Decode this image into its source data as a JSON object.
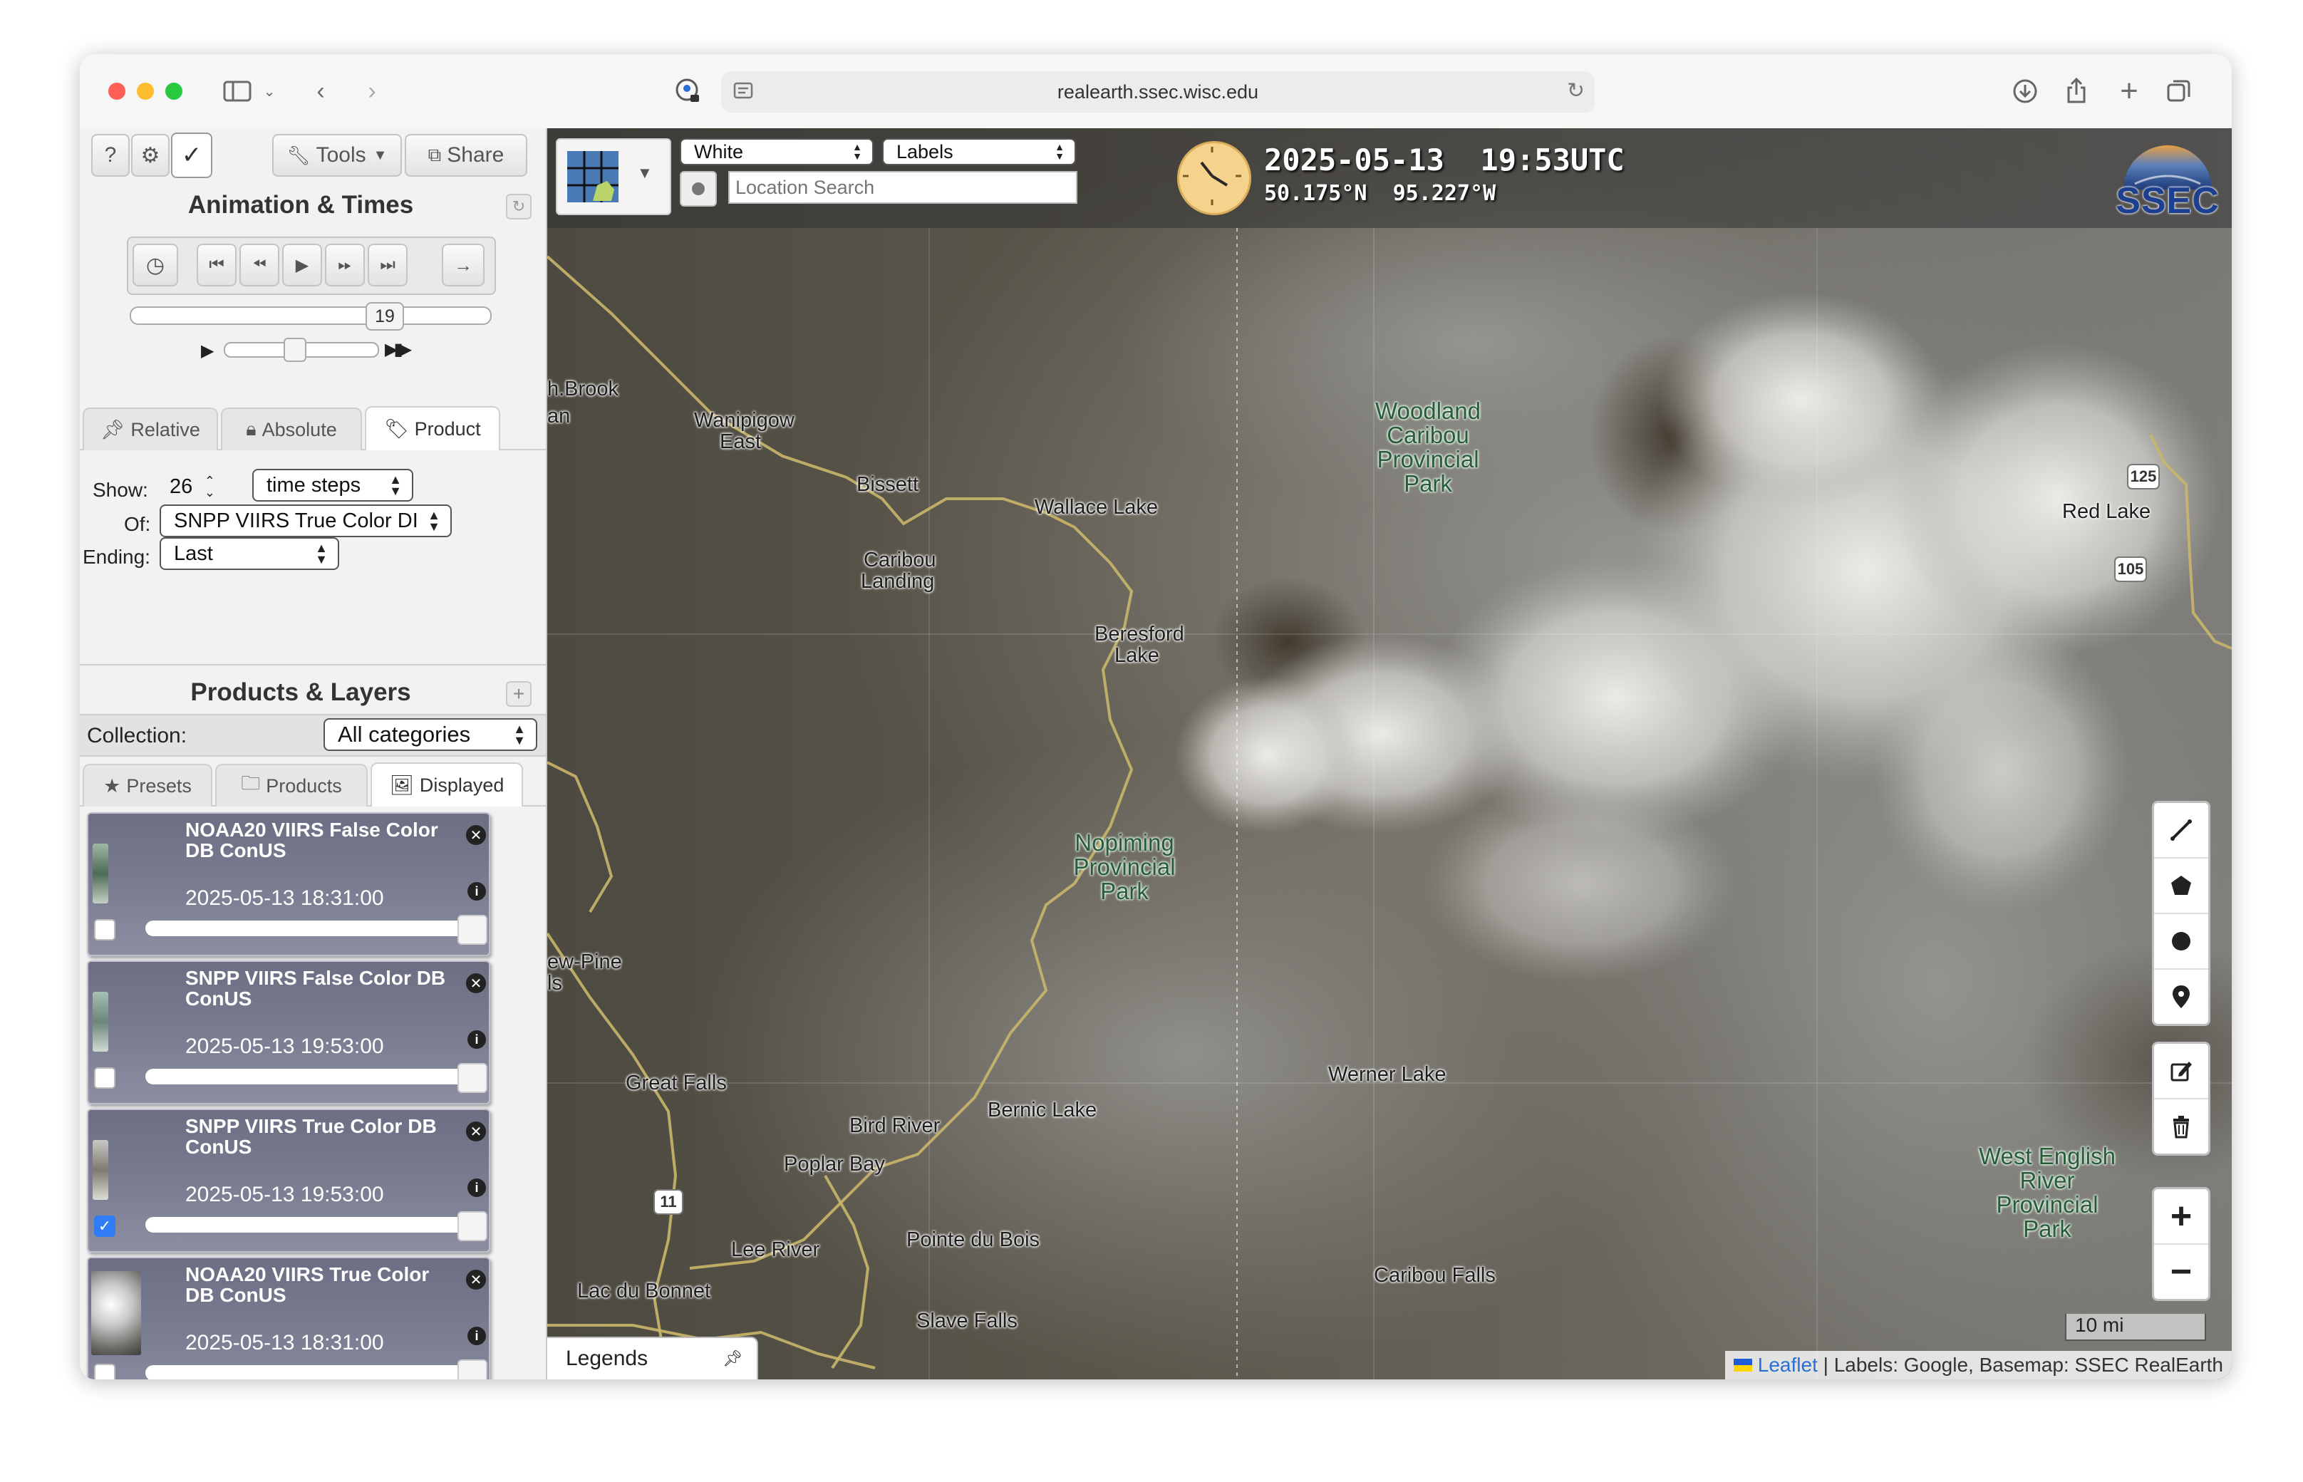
{
  "browser": {
    "url": "realearth.ssec.wisc.edu"
  },
  "toolbar": {
    "help": "?",
    "tools_label": "Tools",
    "share_label": "Share"
  },
  "animation": {
    "title": "Animation & Times",
    "frame_number": "19",
    "tabs": [
      "Relative",
      "Absolute",
      "Product"
    ],
    "show_label": "Show:",
    "show_value": "26",
    "steps_unit": "time steps",
    "of_label": "Of:",
    "of_value": "SNPP VIIRS True Color DI",
    "ending_label": "Ending:",
    "ending_value": "Last",
    "speed_level": 0.45,
    "timeline_position": 0.73
  },
  "layers": {
    "title": "Products & Layers",
    "collection_label": "Collection:",
    "collection_value": "All categories",
    "tabs": [
      "Presets",
      "Products",
      "Displayed"
    ],
    "items": [
      {
        "title": "NOAA20 VIIRS False Color DB ConUS",
        "time": "2025-05-13 18:31:00",
        "checked": false
      },
      {
        "title": "SNPP VIIRS False Color DB ConUS",
        "time": "2025-05-13 19:53:00",
        "checked": false
      },
      {
        "title": "SNPP VIIRS True Color DB ConUS",
        "time": "2025-05-13 19:53:00",
        "checked": true
      },
      {
        "title": "NOAA20 VIIRS True Color DB ConUS",
        "time": "2025-05-13 18:31:00",
        "checked": false
      }
    ]
  },
  "map": {
    "background_select": "White",
    "labels_select": "Labels",
    "search_placeholder": "Location Search",
    "datetime": "2025-05-13  19:53UTC",
    "coords": "50.175°N  95.227°W",
    "logo_text": "SSEC",
    "scale": "10 mi",
    "legends": "Legends",
    "attribution_link": "Leaflet",
    "attribution_text": " | Labels: Google, Basemap: SSEC RealEarth",
    "places": [
      "h.Brook",
      "an",
      "Wanipigow",
      "East",
      "Bissett",
      "Wallace Lake",
      "Caribou",
      "Landing",
      "Beresford",
      "Lake",
      "Red Lake",
      "ew-Pine",
      "ls",
      "Great Falls",
      "Werner Lake",
      "Bernic Lake",
      "Bird River",
      "Poplar Bay",
      "Lee River",
      "Pointe du Bois",
      "Lac du Bonnet",
      "Slave Falls",
      "Caribou Falls"
    ],
    "parks": [
      [
        "Woodland",
        "Caribou",
        "Provincial",
        "Park"
      ],
      [
        "Nopiming",
        "Provincial",
        "Park"
      ],
      [
        "West English",
        "River",
        "Provincial",
        "Park"
      ]
    ],
    "shields": [
      "125",
      "105",
      "11"
    ]
  }
}
